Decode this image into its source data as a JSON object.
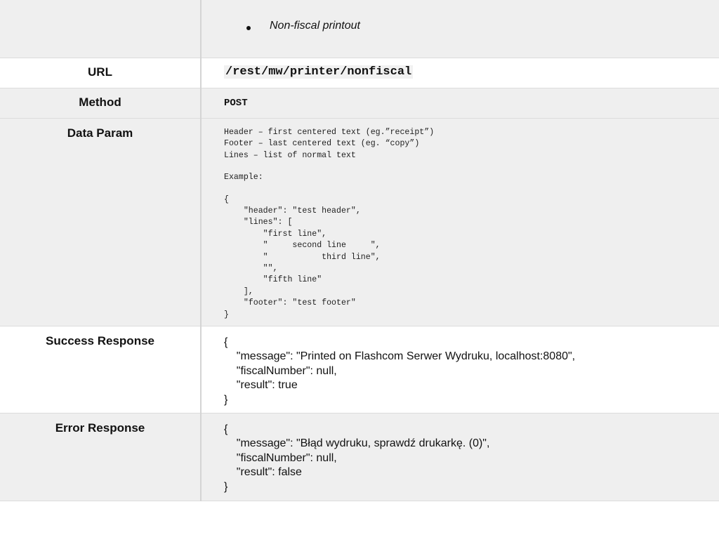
{
  "intro": {
    "bullet": "Non-fiscal printout"
  },
  "url": {
    "label": "URL",
    "value": "/rest/mw/printer/nonfiscal"
  },
  "method": {
    "label": "Method",
    "value": "POST"
  },
  "data_param": {
    "label": "Data Param",
    "descriptions": [
      "Header – first centered text (eg.”receipt”)",
      "Footer – last centered text (eg. “copy”)",
      "Lines – list of normal text"
    ],
    "example_label": "Example:",
    "example_lines": [
      "{",
      "    \"header\": \"test header\",",
      "    \"lines\": [",
      "        \"first line\",",
      "        \"     second line     \",",
      "        \"           third line\",",
      "        \"\",",
      "        \"fifth line\"",
      "    ],",
      "    \"footer\": \"test footer\"",
      "}"
    ]
  },
  "success": {
    "label": "Success Response",
    "lines": [
      "{",
      "    \"message\": \"Printed on Flashcom Serwer Wydruku, localhost:8080\",",
      "    \"fiscalNumber\": null,",
      "    \"result\": true",
      "}"
    ]
  },
  "error": {
    "label": "Error Response",
    "lines": [
      "{",
      "    \"message\": \"Błąd wydruku, sprawdź drukarkę. (0)\",",
      "    \"fiscalNumber\": null,",
      "    \"result\": false",
      "}"
    ]
  }
}
